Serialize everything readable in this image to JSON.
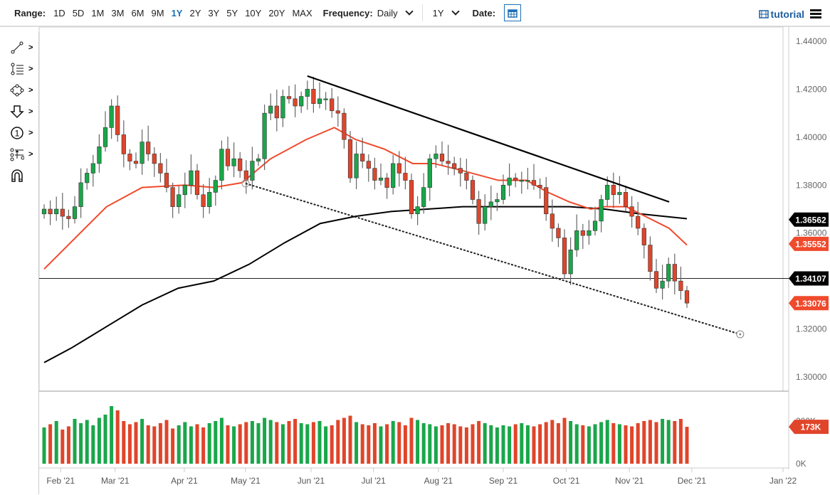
{
  "toolbar": {
    "range_label": "Range:",
    "ranges": [
      "1D",
      "5D",
      "1M",
      "3M",
      "6M",
      "9M",
      "1Y",
      "2Y",
      "3Y",
      "5Y",
      "10Y",
      "20Y",
      "MAX"
    ],
    "active_range": "1Y",
    "frequency_label": "Frequency:",
    "frequency_value": "Daily",
    "period_value": "1Y",
    "date_label": "Date:",
    "tutorial_label": "tutorial",
    "accent": "#1f6fb5"
  },
  "drawing_tools": [
    "line-tool-icon",
    "fibonacci-tool-icon",
    "shape-tool-icon",
    "arrow-down-tool-icon",
    "annotation-number-tool-icon",
    "measure-tool-icon",
    "magnet-icon"
  ],
  "chart_data": {
    "type": "candlestick",
    "ylim": [
      1.3,
      1.44
    ],
    "y_ticks": [
      "1.44000",
      "1.42000",
      "1.40000",
      "1.38000",
      "1.36000",
      "1.34000",
      "1.32000",
      "1.30000"
    ],
    "x_labels": [
      {
        "label": "Feb '21",
        "index": 2.7
      },
      {
        "label": "Mar '21",
        "index": 11.6
      },
      {
        "label": "Apr '21",
        "index": 22.9
      },
      {
        "label": "May '21",
        "index": 32.9
      },
      {
        "label": "Jun '21",
        "index": 43.6
      },
      {
        "label": "Jul '21",
        "index": 53.8
      },
      {
        "label": "Aug '21",
        "index": 64.4
      },
      {
        "label": "Sep '21",
        "index": 75
      },
      {
        "label": "Oct '21",
        "index": 85.3
      },
      {
        "label": "Nov '21",
        "index": 95.6
      },
      {
        "label": "Dec '21",
        "index": 105.8
      },
      {
        "label": "Jan '22",
        "index": 120.7
      }
    ],
    "first_open": 1.368,
    "closes": [
      1.37,
      1.368,
      1.37,
      1.367,
      1.366,
      1.371,
      1.381,
      1.385,
      1.389,
      1.396,
      1.404,
      1.413,
      1.401,
      1.393,
      1.39,
      1.389,
      1.398,
      1.393,
      1.389,
      1.385,
      1.379,
      1.371,
      1.376,
      1.38,
      1.386,
      1.376,
      1.371,
      1.377,
      1.382,
      1.395,
      1.388,
      1.391,
      1.386,
      1.382,
      1.39,
      1.391,
      1.41,
      1.413,
      1.408,
      1.417,
      1.416,
      1.413,
      1.417,
      1.42,
      1.414,
      1.416,
      1.416,
      1.411,
      1.41,
      1.399,
      1.383,
      1.393,
      1.39,
      1.387,
      1.382,
      1.383,
      1.379,
      1.389,
      1.385,
      1.382,
      1.368,
      1.371,
      1.379,
      1.391,
      1.393,
      1.39,
      1.389,
      1.387,
      1.385,
      1.382,
      1.374,
      1.364,
      1.371,
      1.373,
      1.374,
      1.38,
      1.383,
      1.382,
      1.382,
      1.382,
      1.38,
      1.379,
      1.368,
      1.362,
      1.358,
      1.343,
      1.353,
      1.361,
      1.359,
      1.361,
      1.365,
      1.374,
      1.38,
      1.376,
      1.377,
      1.371,
      1.367,
      1.362,
      1.355,
      1.344,
      1.337,
      1.34,
      1.347,
      1.34,
      1.336,
      1.3308
    ],
    "volumes_k": [
      170,
      185,
      200,
      160,
      175,
      210,
      190,
      205,
      180,
      215,
      230,
      270,
      250,
      200,
      185,
      195,
      210,
      180,
      175,
      190,
      205,
      165,
      180,
      195,
      175,
      185,
      170,
      190,
      200,
      215,
      180,
      175,
      185,
      195,
      200,
      190,
      215,
      205,
      195,
      185,
      200,
      210,
      190,
      185,
      195,
      200,
      175,
      180,
      205,
      215,
      225,
      195,
      185,
      180,
      190,
      175,
      185,
      200,
      195,
      180,
      215,
      205,
      190,
      185,
      175,
      180,
      190,
      185,
      175,
      170,
      185,
      200,
      190,
      180,
      170,
      180,
      175,
      185,
      190,
      180,
      175,
      185,
      195,
      205,
      190,
      215,
      200,
      185,
      180,
      175,
      185,
      195,
      205,
      190,
      185,
      180,
      175,
      190,
      200,
      205,
      195,
      210,
      205,
      200,
      210,
      173
    ],
    "volume_ylim": [
      0,
      300
    ],
    "volume_ticks": [
      "200K",
      "0K"
    ],
    "ma50": [
      [
        0,
        1.345
      ],
      [
        10.2,
        1.371
      ],
      [
        16,
        1.379
      ],
      [
        23,
        1.38
      ],
      [
        27.7,
        1.379
      ],
      [
        32.3,
        1.381
      ],
      [
        37,
        1.391
      ],
      [
        42.8,
        1.399
      ],
      [
        47.4,
        1.404
      ],
      [
        50.9,
        1.399
      ],
      [
        55.6,
        1.395
      ],
      [
        60.2,
        1.389
      ],
      [
        63.7,
        1.389
      ],
      [
        68.4,
        1.386
      ],
      [
        74.2,
        1.382
      ],
      [
        78.8,
        1.382
      ],
      [
        82.3,
        1.377
      ],
      [
        85.8,
        1.373
      ],
      [
        89.3,
        1.37
      ],
      [
        91.6,
        1.371
      ],
      [
        95.1,
        1.371
      ],
      [
        97.4,
        1.368
      ],
      [
        102.1,
        1.362
      ],
      [
        105,
        1.355
      ]
    ],
    "ma200": [
      [
        0,
        1.306
      ],
      [
        4.4,
        1.312
      ],
      [
        10.2,
        1.321
      ],
      [
        16,
        1.33
      ],
      [
        21.9,
        1.337
      ],
      [
        27.7,
        1.34
      ],
      [
        33.5,
        1.347
      ],
      [
        39.3,
        1.356
      ],
      [
        45.1,
        1.364
      ],
      [
        50.9,
        1.367
      ],
      [
        56.7,
        1.369
      ],
      [
        62.6,
        1.37
      ],
      [
        68.4,
        1.371
      ],
      [
        74.2,
        1.371
      ],
      [
        80,
        1.371
      ],
      [
        85.8,
        1.371
      ],
      [
        91.6,
        1.37
      ],
      [
        97.4,
        1.368
      ],
      [
        105,
        1.366
      ]
    ],
    "trendline_upper": [
      [
        43.0,
        1.4255
      ],
      [
        102.1,
        1.373
      ]
    ],
    "trendline_lower": [
      [
        32.9,
        1.3807
      ],
      [
        113.7,
        1.3178
      ]
    ],
    "horizontal_level": 1.34107,
    "price_tags": [
      {
        "value": "1.36562",
        "color": "#000000",
        "price": 1.36562
      },
      {
        "value": "1.35552",
        "color": "#f04a2c",
        "price": 1.35552
      },
      {
        "value": "1.34107",
        "color": "#000000",
        "price": 1.34107
      },
      {
        "value": "1.33076",
        "color": "#f04a2c",
        "price": 1.33076
      }
    ],
    "volume_tag": "173K",
    "up_color": "#1aa64a",
    "down_color": "#e0452a",
    "ma50_color": "#f04a2c",
    "ma200_color": "#000000"
  }
}
